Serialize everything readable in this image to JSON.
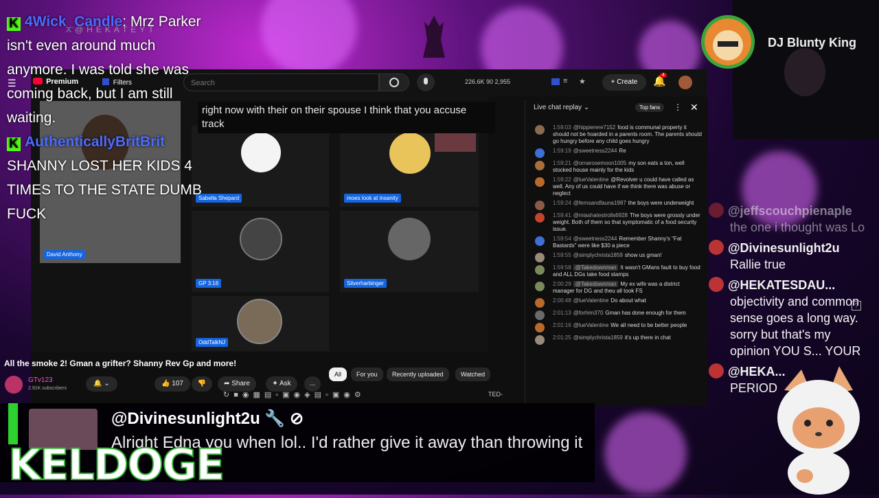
{
  "left_chat": {
    "messages": [
      {
        "user": "4Wick_Candle",
        "sep": ": ",
        "text": "Mrz Parker isn't even around much anymore. I was told she was coming back, but I am still waiting."
      },
      {
        "user": "AuthenticallyBritBrit",
        "sep": " ",
        "text": "SHANNY LOST HER KIDS 4 TIMES TO THE STATE DUMB FUCK"
      }
    ],
    "watermark": "X@HEKATEYT"
  },
  "youtube": {
    "premium_label": "Premium",
    "filters_label": "Filters",
    "search_placeholder": "Search",
    "stats": "226.6K  90  2,955",
    "create_label": "Create",
    "notif_count": "4",
    "caption": "right now with their on their spouse I think that you accuse track",
    "tiles": [
      "Sabella Shepard",
      "moes look at insanity",
      "David Anthony",
      "GP 3:16",
      "Silverharbinger",
      "OddTalkNJ"
    ],
    "video_title": "All the smoke 2! Gman a grifter? Shanny Rev Gp and more!",
    "channel_name": "GTv123",
    "channel_subs": "2.91K subscribers",
    "likes": "107",
    "share_label": "Share",
    "ask_label": "Ask",
    "more_label": "...",
    "chips": [
      "All",
      "For you",
      "Recently uploaded",
      "Watched"
    ],
    "toolbar_end": "TED-"
  },
  "live_chat": {
    "title": "Live chat replay",
    "top_fans": "Top fans",
    "messages": [
      {
        "time": "1:59:03",
        "user": "@hippierere7152",
        "text": "food is communal property it should not be hoarded in a parents room. The parents should go hungry before any child goes hungry",
        "color": "#8a6b4c"
      },
      {
        "time": "1:59:19",
        "user": "@sweetness2244",
        "text": "Re",
        "color": "#3e6fd4"
      },
      {
        "time": "1:59:21",
        "user": "@ornarosemoon1005",
        "text": "my son eats a ton, well stocked house mainly for the kids",
        "color": "#a86f3a"
      },
      {
        "time": "1:59:22",
        "user": "@lueValentine",
        "text": "@Revolver u could have called as well. Any of us could have if we think there was abuse or neglect",
        "color": "#b86a2c"
      },
      {
        "time": "1:59:24",
        "user": "@fernsandfauna1987",
        "text": "the boys were underweight",
        "color": "#8a5c48"
      },
      {
        "time": "1:59:41",
        "user": "@miashatestrolls6928",
        "text": "The boys were grossly under weight. Both of them so that symptomatic of a food security issue.",
        "color": "#c4442a"
      },
      {
        "time": "1:59:54",
        "user": "@sweetness2244",
        "text": "Remember Shanny's \"Fat Bastards\" were like $30 a piece",
        "color": "#3e6fd4"
      },
      {
        "time": "1:59:55",
        "user": "@simplychrista1859",
        "text": "show us gman!",
        "color": "#9a8a7a"
      },
      {
        "time": "1:59:58",
        "user": "@Takedownman",
        "text": "It wasn't GMans fault to buy food and ALL DGs take food stamps",
        "color": "#7a8a5a",
        "tag": true
      },
      {
        "time": "2:00:29",
        "user": "@Takedownman",
        "text": "My ex wife was a district manager for DG and theu all took FS",
        "color": "#7a8a5a",
        "tag": true
      },
      {
        "time": "2:00:48",
        "user": "@lueValentine",
        "text": "Do about what",
        "color": "#b86a2c"
      },
      {
        "time": "2:01:13",
        "user": "@forhim370",
        "text": "Gman has done enough for them",
        "color": "#6a6a6a"
      },
      {
        "time": "2:01:16",
        "user": "@lueValentine",
        "text": "We all need to be better people",
        "color": "#b86a2c"
      },
      {
        "time": "2:01:25",
        "user": "@simplychrista1859",
        "text": "it's up there in chat",
        "color": "#9a8a7a"
      }
    ]
  },
  "right_panel": {
    "dj_name": "DJ Blunty King",
    "messages": [
      {
        "user": "@jeffscouchpienaple",
        "text": "the one i thought was Lo",
        "faded": true
      },
      {
        "user": "@Divinesunlight2u",
        "text": "Rallie true"
      },
      {
        "user": "@HEKATESDAU...",
        "text": "objectivity and common sense goes a long way. sorry but that's my opinion YOU S... YOUR"
      },
      {
        "user": "@HEKA...",
        "text": "PERIOD"
      }
    ]
  },
  "bottom_chat": {
    "user": "@Divinesunlight2u",
    "message": "Alright Edna you when lol.. I'd rather give it away than throwing it"
  },
  "brand": {
    "logo_text": "KELDOGE"
  },
  "colors": {
    "kick_green": "#53fc18",
    "yt_bg": "#0f0f0f",
    "accent_blue": "#1565e0",
    "keldoge_green": "#2fb02f"
  }
}
